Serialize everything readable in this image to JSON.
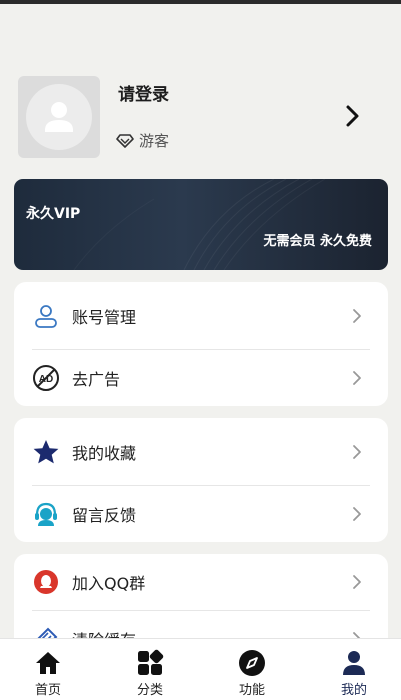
{
  "profile": {
    "login_text": "请登录",
    "role": "游客"
  },
  "vip": {
    "title": "永久VIP",
    "subtitle": "无需会员 永久免费"
  },
  "menu_groups": [
    {
      "items": [
        {
          "label": "账号管理",
          "icon": "user-icon"
        },
        {
          "label": "去广告",
          "icon": "no-ad-icon"
        }
      ]
    },
    {
      "items": [
        {
          "label": "我的收藏",
          "icon": "star-icon"
        },
        {
          "label": "留言反馈",
          "icon": "headset-icon"
        }
      ]
    },
    {
      "items": [
        {
          "label": "加入QQ群",
          "icon": "qq-icon"
        },
        {
          "label": "清除缓存",
          "icon": "broom-icon"
        }
      ]
    }
  ],
  "tabbar": {
    "tabs": [
      {
        "label": "首页",
        "icon": "home-icon"
      },
      {
        "label": "分类",
        "icon": "grid-icon"
      },
      {
        "label": "功能",
        "icon": "compass-icon"
      },
      {
        "label": "我的",
        "icon": "profile-icon",
        "active": true
      }
    ]
  },
  "colors": {
    "accent": "#1c2a55",
    "user_icon": "#3a78c2",
    "qq_icon": "#d9362b",
    "vip_bg": "#22303f"
  }
}
